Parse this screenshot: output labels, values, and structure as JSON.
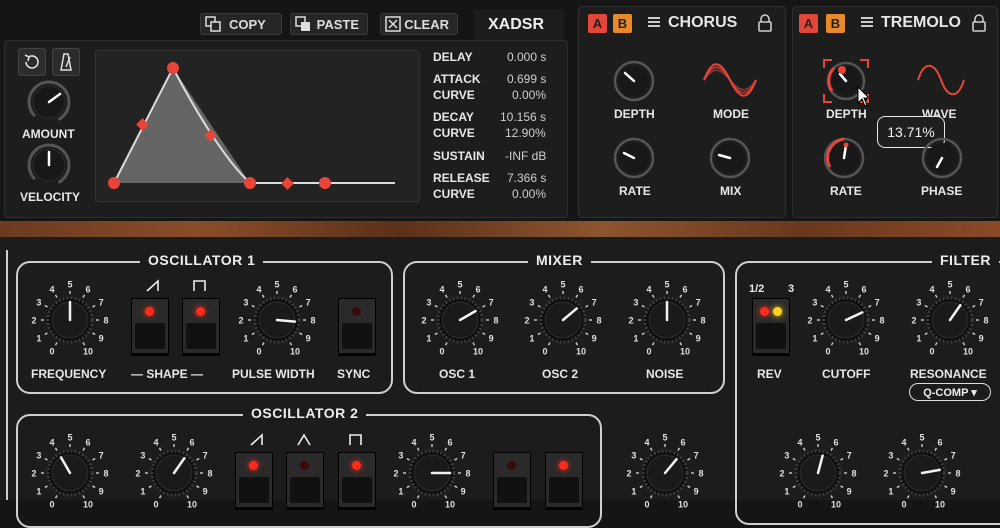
{
  "toolbar": {
    "copy_label": "COPY",
    "paste_label": "PASTE",
    "clear_label": "CLEAR",
    "envelope_title": "XADSR"
  },
  "envelope": {
    "amount_label": "AMOUNT",
    "velocity_label": "VELOCITY",
    "params": [
      {
        "name": "DELAY",
        "value": "0.000 s"
      },
      {
        "name": "ATTACK",
        "value": "0.699 s"
      },
      {
        "name": "CURVE",
        "value": "0.00%"
      },
      {
        "name": "DECAY",
        "value": "10.156 s"
      },
      {
        "name": "CURVE",
        "value": "12.90%"
      },
      {
        "name": "SUSTAIN",
        "value": "-INF dB"
      },
      {
        "name": "RELEASE",
        "value": "7.366 s"
      },
      {
        "name": "CURVE",
        "value": "0.00%"
      }
    ]
  },
  "chorus": {
    "a_label": "A",
    "b_label": "B",
    "title": "CHORUS",
    "depth_label": "DEPTH",
    "mode_label": "MODE",
    "rate_label": "RATE",
    "mix_label": "MIX"
  },
  "tremolo": {
    "a_label": "A",
    "b_label": "B",
    "title": "TREMOLO",
    "depth_label": "DEPTH",
    "wave_label": "WAVE",
    "rate_label": "RATE",
    "phase_label": "PHASE",
    "tooltip": "13.71%"
  },
  "osc1": {
    "title": "OSCILLATOR 1",
    "frequency_label": "FREQUENCY",
    "shape_label": "— SHAPE —",
    "pulse_width_label": "PULSE WIDTH",
    "sync_label": "SYNC"
  },
  "mixer": {
    "title": "MIXER",
    "osc1_label": "OSC 1",
    "osc2_label": "OSC 2",
    "noise_label": "NOISE"
  },
  "filter": {
    "title": "FILTER",
    "rev_options": [
      "1/2",
      "3"
    ],
    "rev_label": "REV",
    "cutoff_label": "CUTOFF",
    "resonance_label": "RESONANCE",
    "qcomp_label": "Q-COMP ▾"
  },
  "osc2": {
    "title": "OSCILLATOR 2"
  },
  "scale_numbers": [
    "0",
    "1",
    "2",
    "3",
    "4",
    "5",
    "6",
    "7",
    "8",
    "9",
    "10"
  ],
  "colors": {
    "accent_red": "#e4463a",
    "accent_orange": "#e88a2b",
    "led_red": "#ff2a1a",
    "led_yellow": "#ffd21a"
  }
}
